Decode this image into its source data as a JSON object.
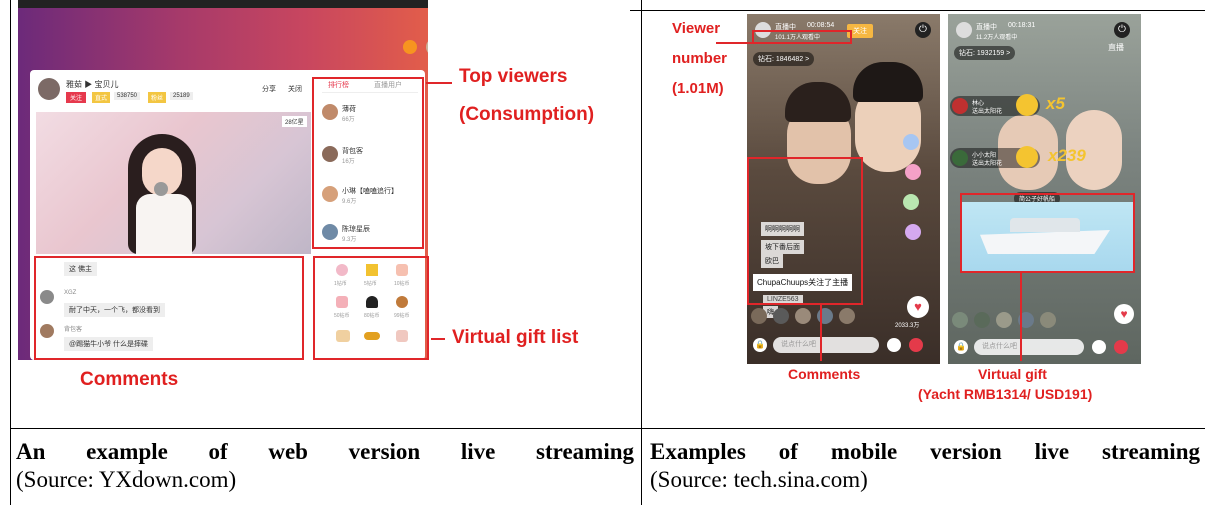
{
  "left_panel": {
    "annotations": {
      "top_viewers_1": "Top viewers",
      "top_viewers_2": "(Consumption)",
      "virtual_gift_list": "Virtual gift list",
      "comments": "Comments"
    },
    "streamer": {
      "name": "雅茹 ▶ 宝贝儿",
      "follow": "关注",
      "tag1": "直式",
      "count1": "538750",
      "tag2": "粉丝",
      "count2": "25189",
      "share": "分享",
      "close": "关闭",
      "badge": "28亿星"
    },
    "rank_tabs": [
      "排行榜",
      "直播用户"
    ],
    "top_viewers": [
      {
        "name": "薄荷",
        "value": "66万"
      },
      {
        "name": "背包客",
        "value": "16万"
      },
      {
        "name": "小琳【嗑嗑追行】",
        "value": "9.6万"
      },
      {
        "name": "陈琼星辰",
        "value": "9.3万"
      }
    ],
    "comments": [
      {
        "user": "",
        "text": "这 佛主"
      },
      {
        "user": "XGZ",
        "text": "耐了中天，一个飞，都没看到"
      },
      {
        "user": "背包客",
        "text": "@踢猫牛小爷 什么是摔碟"
      }
    ],
    "gift_prices": [
      "1钻币",
      "5钻币",
      "10钻币",
      "50钻币",
      "80钻币",
      "99钻币"
    ]
  },
  "right_panel": {
    "annotations": {
      "viewer_number_1": "Viewer",
      "viewer_number_2": "number",
      "viewer_number_3": "(1.01M)",
      "comments": "Comments",
      "virtual_gift": "Virtual gift",
      "yacht_price": "(Yacht RMB1314/ USD191)"
    },
    "phone1": {
      "status": "直播中",
      "time": "00:08:54",
      "viewers": "101.1万人观看中",
      "follow": "关注",
      "diamonds": "钻石: 1846482 >",
      "chat": [
        "啊啊啊啊啊",
        "坡下番后面",
        "欧巴",
        "ChupaChuups关注了主播",
        "LINZE563",
        "嗨"
      ],
      "total": "2033.3万",
      "input_placeholder": "说点什么吧"
    },
    "phone2": {
      "status": "直播中",
      "time": "00:18:31",
      "viewers": "11.2万人观看中",
      "diamonds": "钻石: 1932159 >",
      "top_right": "直播",
      "gift1_user": "林心",
      "gift1_text": "送出太阳花",
      "gift1_multi": "x5",
      "gift2_user": "小小太阳",
      "gift2_text": "送出太阳花",
      "gift2_multi": "x239",
      "yacht_label": "简公子好帆船",
      "input_placeholder": "说点什么吧"
    }
  },
  "captions": {
    "left_bold": "An example of web version live streaming",
    "left_source": "(Source: YXdown.com)",
    "right_bold": "Examples of mobile version live streaming",
    "right_source": "(Source: tech.sina.com)"
  }
}
